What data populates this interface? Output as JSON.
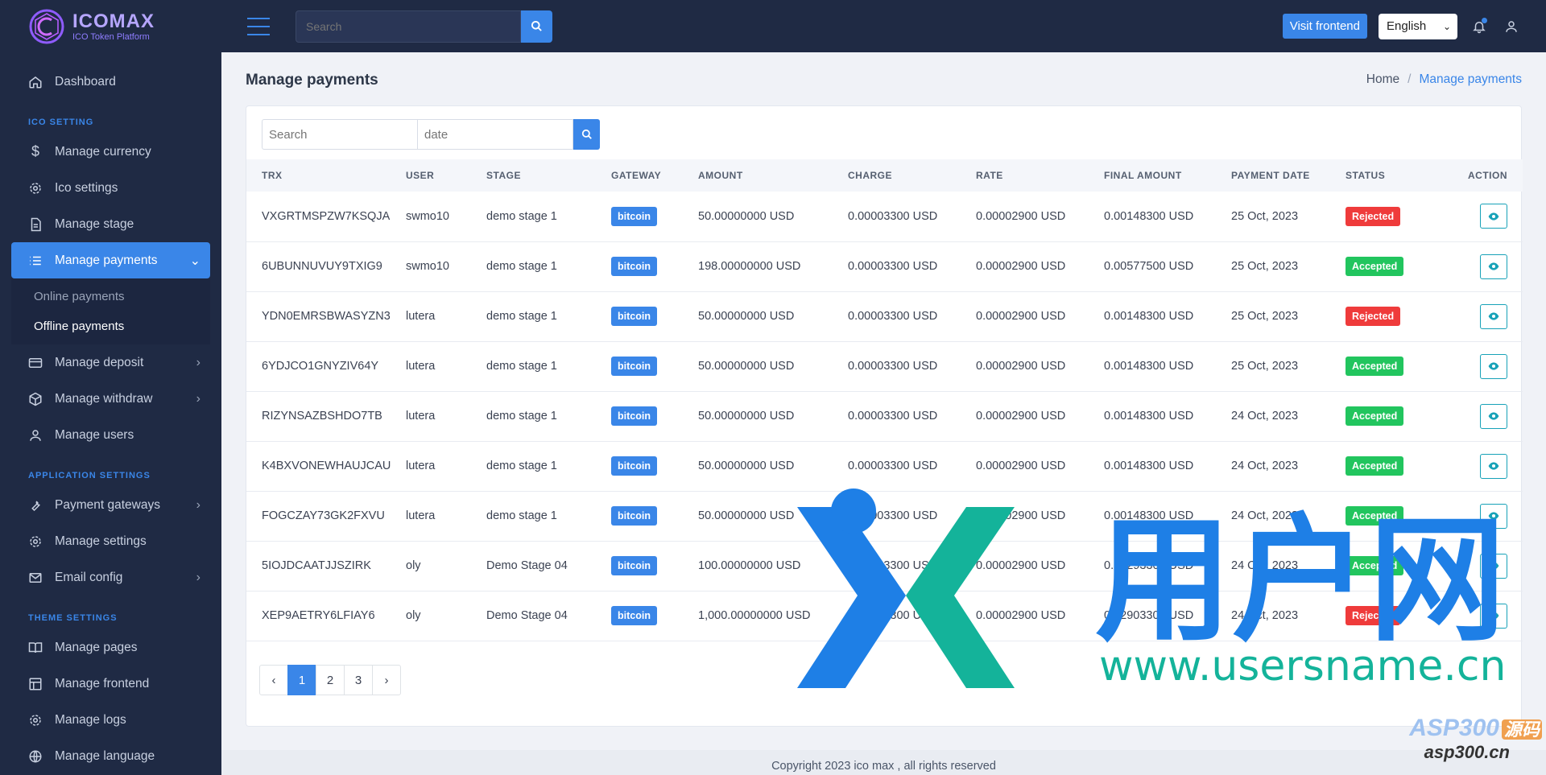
{
  "brand": {
    "name": "ICOMAX",
    "subtitle": "ICO Token Platform"
  },
  "sidebar": {
    "items": [
      {
        "label": "Dashboard",
        "icon": "home-icon"
      },
      {
        "section": "ICO SETTING"
      },
      {
        "label": "Manage currency",
        "icon": "dollar-icon"
      },
      {
        "label": "Ico settings",
        "icon": "gear-icon"
      },
      {
        "label": "Manage stage",
        "icon": "document-icon"
      },
      {
        "label": "Manage payments",
        "icon": "list-icon"
      },
      {
        "label": "Manage deposit",
        "icon": "card-icon"
      },
      {
        "label": "Manage withdraw",
        "icon": "box-icon"
      },
      {
        "label": "Manage users",
        "icon": "user-icon"
      },
      {
        "section": "APPLICATION SETTINGS"
      },
      {
        "label": "Payment gateways",
        "icon": "wrench-icon"
      },
      {
        "label": "Manage settings",
        "icon": "gear-icon"
      },
      {
        "label": "Email config",
        "icon": "mail-icon"
      },
      {
        "section": "THEME SETTINGS"
      },
      {
        "label": "Manage pages",
        "icon": "book-icon"
      },
      {
        "label": "Manage frontend",
        "icon": "layout-icon"
      },
      {
        "label": "Manage logs",
        "icon": "gear-icon"
      },
      {
        "label": "Manage language",
        "icon": "globe-icon"
      }
    ],
    "sections": {
      "ico": "ICO SETTING",
      "app": "APPLICATION SETTINGS",
      "theme": "THEME SETTINGS"
    },
    "sub_items": [
      "Online payments",
      "Offline payments"
    ]
  },
  "topbar": {
    "search_placeholder": "Search",
    "visit_frontend": "Visit frontend",
    "language": "English"
  },
  "page": {
    "title": "Manage payments",
    "breadcrumb": {
      "home": "Home",
      "current": "Manage payments"
    }
  },
  "filter": {
    "search_placeholder": "Search",
    "date_placeholder": "date"
  },
  "table": {
    "headers": [
      "TRX",
      "USER",
      "STAGE",
      "GATEWAY",
      "AMOUNT",
      "CHARGE",
      "RATE",
      "FINAL AMOUNT",
      "PAYMENT DATE",
      "STATUS",
      "ACTION"
    ],
    "rows": [
      {
        "trx": "VXGRTMSPZW7KSQJA",
        "user": "swmo10",
        "stage": "demo stage 1",
        "gateway": "bitcoin",
        "amount": "50.00000000 USD",
        "charge": "0.00003300 USD",
        "rate": "0.00002900 USD",
        "final": "0.00148300 USD",
        "date": "25 Oct, 2023",
        "status": "Rejected"
      },
      {
        "trx": "6UBUNNUVUY9TXIG9",
        "user": "swmo10",
        "stage": "demo stage 1",
        "gateway": "bitcoin",
        "amount": "198.00000000 USD",
        "charge": "0.00003300 USD",
        "rate": "0.00002900 USD",
        "final": "0.00577500 USD",
        "date": "25 Oct, 2023",
        "status": "Accepted"
      },
      {
        "trx": "YDN0EMRSBWASYZN3",
        "user": "lutera",
        "stage": "demo stage 1",
        "gateway": "bitcoin",
        "amount": "50.00000000 USD",
        "charge": "0.00003300 USD",
        "rate": "0.00002900 USD",
        "final": "0.00148300 USD",
        "date": "25 Oct, 2023",
        "status": "Rejected"
      },
      {
        "trx": "6YDJCO1GNYZIV64Y",
        "user": "lutera",
        "stage": "demo stage 1",
        "gateway": "bitcoin",
        "amount": "50.00000000 USD",
        "charge": "0.00003300 USD",
        "rate": "0.00002900 USD",
        "final": "0.00148300 USD",
        "date": "25 Oct, 2023",
        "status": "Accepted"
      },
      {
        "trx": "RIZYNSAZBSHDO7TB",
        "user": "lutera",
        "stage": "demo stage 1",
        "gateway": "bitcoin",
        "amount": "50.00000000 USD",
        "charge": "0.00003300 USD",
        "rate": "0.00002900 USD",
        "final": "0.00148300 USD",
        "date": "24 Oct, 2023",
        "status": "Accepted"
      },
      {
        "trx": "K4BXVONEWHAUJCAU",
        "user": "lutera",
        "stage": "demo stage 1",
        "gateway": "bitcoin",
        "amount": "50.00000000 USD",
        "charge": "0.00003300 USD",
        "rate": "0.00002900 USD",
        "final": "0.00148300 USD",
        "date": "24 Oct, 2023",
        "status": "Accepted"
      },
      {
        "trx": "FOGCZAY73GK2FXVU",
        "user": "lutera",
        "stage": "demo stage 1",
        "gateway": "bitcoin",
        "amount": "50.00000000 USD",
        "charge": "0.00003300 USD",
        "rate": "0.00002900 USD",
        "final": "0.00148300 USD",
        "date": "24 Oct, 2023",
        "status": "Accepted"
      },
      {
        "trx": "5IOJDCAATJJSZIRK",
        "user": "oly",
        "stage": "Demo Stage 04",
        "gateway": "bitcoin",
        "amount": "100.00000000 USD",
        "charge": "0.00003300 USD",
        "rate": "0.00002900 USD",
        "final": "0.00293300 USD",
        "date": "24 Oct, 2023",
        "status": "Accepted"
      },
      {
        "trx": "XEP9AETRY6LFIAY6",
        "user": "oly",
        "stage": "Demo Stage 04",
        "gateway": "bitcoin",
        "amount": "1,000.00000000 USD",
        "charge": "0.00003300 USD",
        "rate": "0.00002900 USD",
        "final": "0.02903300 USD",
        "date": "24 Oct, 2023",
        "status": "Rejected"
      }
    ]
  },
  "pagination": {
    "prev": "‹",
    "pages": [
      "1",
      "2",
      "3"
    ],
    "next": "›",
    "current": "1"
  },
  "footer": "Copyright 2023 ico max , all rights reserved",
  "watermark": {
    "url": "www.usersname.cn",
    "brand_cn": "用户网",
    "site": "ASP300",
    "site_cn": "源码",
    "site_url": "asp300.cn"
  },
  "colors": {
    "sidebar_bg": "#1f2a44",
    "accent": "#3a86e8",
    "accepted": "#22c55e",
    "rejected": "#ef3b3b"
  }
}
